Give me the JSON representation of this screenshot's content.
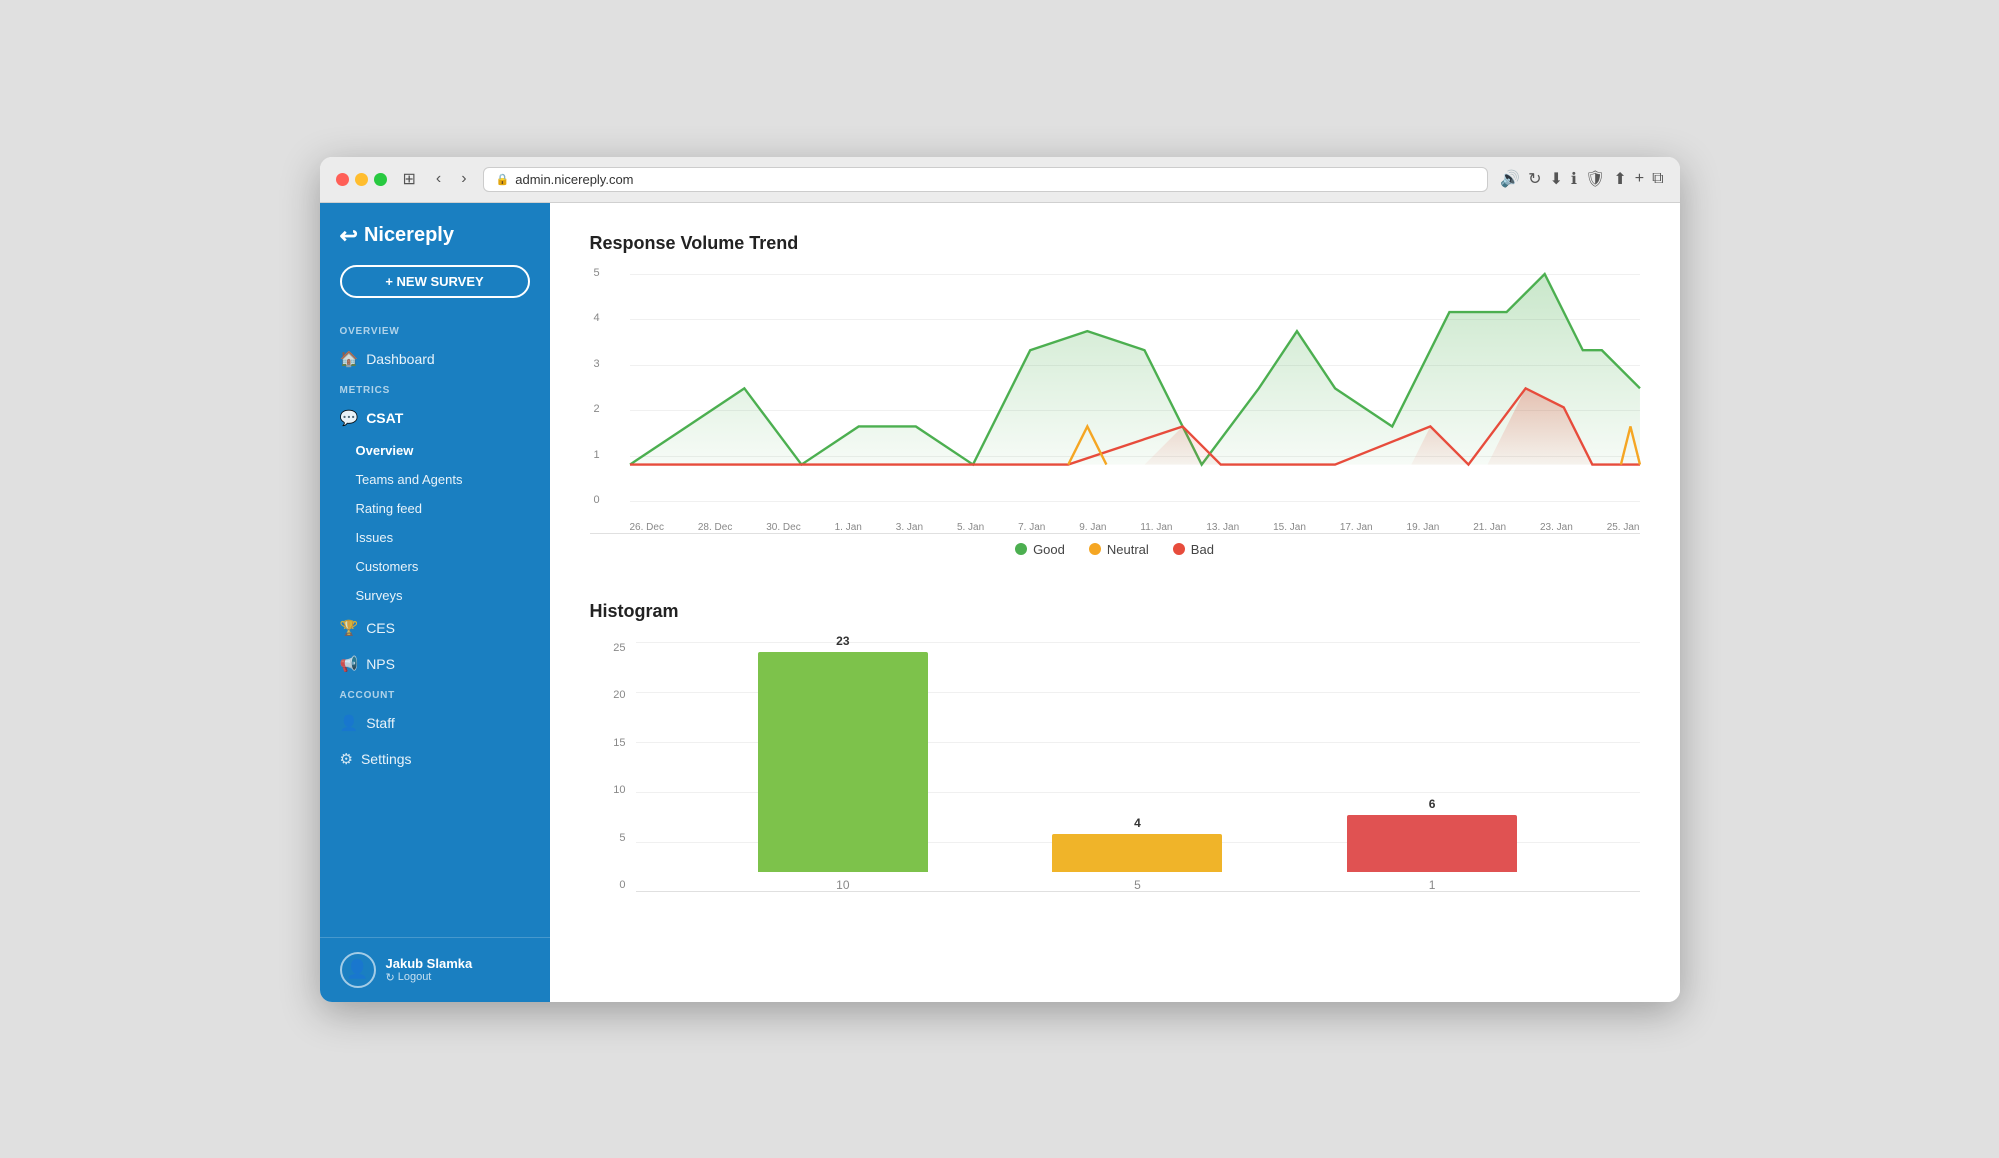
{
  "browser": {
    "url": "admin.nicereply.com"
  },
  "sidebar": {
    "logo": "Nicereply",
    "new_survey_btn": "+ NEW SURVEY",
    "overview_label": "OVERVIEW",
    "dashboard_item": "Dashboard",
    "metrics_label": "METRICS",
    "csat_item": "CSAT",
    "csat_subitems": [
      {
        "label": "Overview",
        "active": true
      },
      {
        "label": "Teams and Agents",
        "active": false
      },
      {
        "label": "Rating feed",
        "active": false
      },
      {
        "label": "Issues",
        "active": false
      },
      {
        "label": "Customers",
        "active": false
      },
      {
        "label": "Surveys",
        "active": false
      }
    ],
    "ces_item": "CES",
    "nps_item": "NPS",
    "account_label": "ACCOUNT",
    "staff_item": "Staff",
    "settings_item": "Settings",
    "user": {
      "name": "Jakub Slamka",
      "logout": "Logout"
    }
  },
  "main": {
    "trend_chart": {
      "title": "Response Volume Trend",
      "y_labels": [
        "5",
        "4",
        "3",
        "2",
        "1",
        "0"
      ],
      "x_labels": [
        "26. Dec",
        "28. Dec",
        "30. Dec",
        "1. Jan",
        "3. Jan",
        "5. Jan",
        "7. Jan",
        "9. Jan",
        "11. Jan",
        "13. Jan",
        "15. Jan",
        "17. Jan",
        "19. Jan",
        "21. Jan",
        "23. Jan",
        "25. Jan"
      ],
      "legend": [
        {
          "label": "Good",
          "color": "#4caf50"
        },
        {
          "label": "Neutral",
          "color": "#f5a623"
        },
        {
          "label": "Bad",
          "color": "#e74c3c"
        }
      ]
    },
    "histogram": {
      "title": "Histogram",
      "y_labels": [
        "25",
        "20",
        "15",
        "10",
        "5",
        "0"
      ],
      "bars": [
        {
          "value": 23,
          "label": "10",
          "color": "#7dc24b",
          "height_pct": 92
        },
        {
          "value": 4,
          "label": "5",
          "color": "#f0b429",
          "height_pct": 16
        },
        {
          "value": 6,
          "label": "1",
          "color": "#e05252",
          "height_pct": 24
        }
      ]
    }
  }
}
